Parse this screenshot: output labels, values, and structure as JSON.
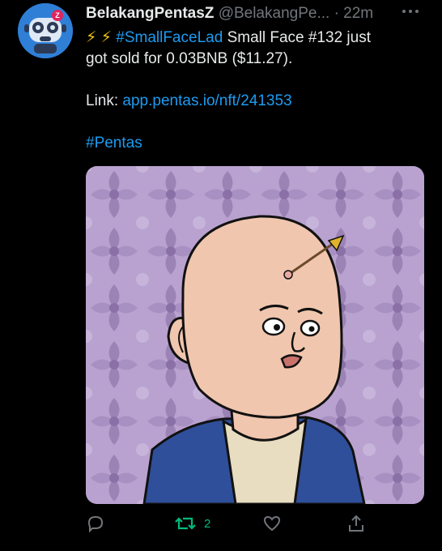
{
  "tweet": {
    "display_name": "BelakangPentasZ",
    "handle": "@BelakangPe...",
    "separator": "·",
    "time": "22m",
    "avatar_badge": "Z",
    "line1_bolts": "⚡ ⚡",
    "hashtag1": "#SmallFaceLad",
    "line1_rest": "Small Face #132 just",
    "line2": "got sold for 0.03BNB ($11.27).",
    "link_label": "Link:",
    "link_url": "app.pentas.io/nft/241353",
    "hashtag2": "#Pentas"
  },
  "actions": {
    "reply_icon": "reply-icon",
    "retweet_icon": "retweet-icon",
    "retweet_count": "2",
    "like_icon": "heart-icon",
    "share_icon": "share-icon"
  },
  "colors": {
    "background": "#000000",
    "text": "#e7e9ea",
    "muted": "#71767b",
    "link": "#1d9bf0",
    "retweet_green": "#00ba7c",
    "media_background": "#b9a2cf"
  }
}
